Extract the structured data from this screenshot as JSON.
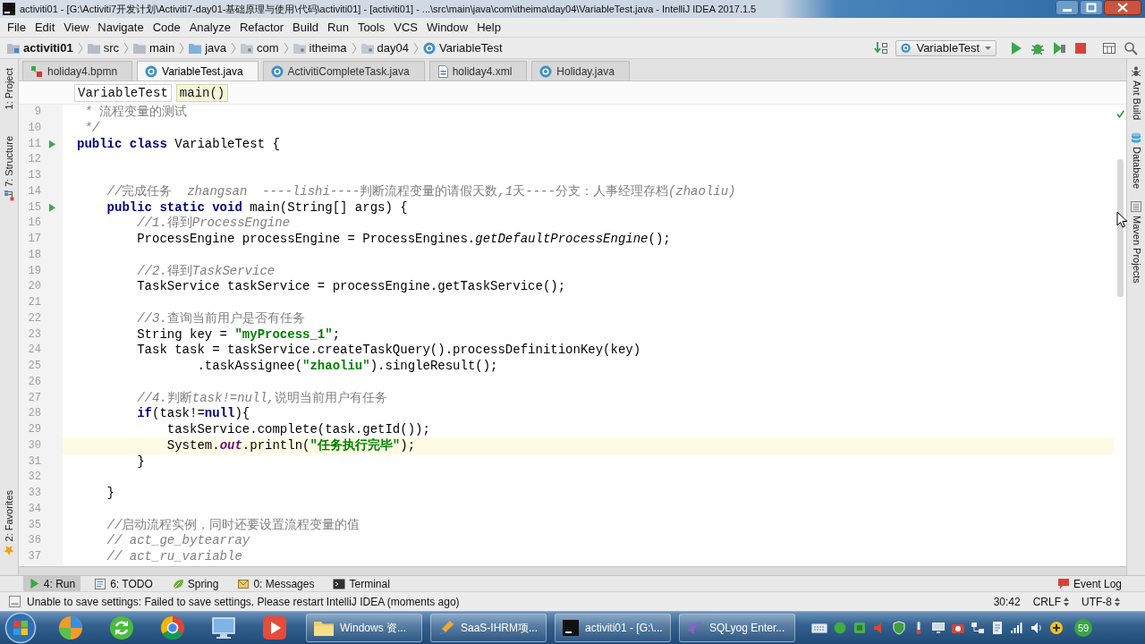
{
  "window": {
    "title": "activiti01 - [G:\\Activiti7开发计划\\Activiti7-day01-基础原理与使用\\代码\\activiti01] - [activiti01] - ...\\src\\main\\java\\com\\itheima\\day04\\VariableTest.java - IntelliJ IDEA 2017.1.5"
  },
  "menu": [
    "File",
    "Edit",
    "View",
    "Navigate",
    "Code",
    "Analyze",
    "Refactor",
    "Build",
    "Run",
    "Tools",
    "VCS",
    "Window",
    "Help"
  ],
  "navigation": {
    "breadcrumbs": [
      {
        "label": "activiti01",
        "kind": "module"
      },
      {
        "label": "src",
        "kind": "folder"
      },
      {
        "label": "main",
        "kind": "folder"
      },
      {
        "label": "java",
        "kind": "source"
      },
      {
        "label": "com",
        "kind": "package"
      },
      {
        "label": "itheima",
        "kind": "package"
      },
      {
        "label": "day04",
        "kind": "package"
      },
      {
        "label": "VariableTest",
        "kind": "class"
      }
    ],
    "run_configuration": "VariableTest"
  },
  "left_tool_strip": {
    "top": [
      {
        "label": "1: Project",
        "kind": "project"
      },
      {
        "label": "7: Structure",
        "kind": "structure"
      }
    ],
    "bottom": [
      {
        "label": "2: Favorites",
        "kind": "favorites"
      }
    ]
  },
  "tabs": [
    {
      "label": "holiday4.bpmn",
      "kind": "bpmn",
      "selected": false
    },
    {
      "label": "VariableTest.java",
      "kind": "java",
      "selected": true
    },
    {
      "label": "ActivitiCompleteTask.java",
      "kind": "java",
      "selected": false
    },
    {
      "label": "holiday4.xml",
      "kind": "xml",
      "selected": false
    },
    {
      "label": "Holiday.java",
      "kind": "java",
      "selected": false
    }
  ],
  "editor": {
    "breadcrumbs": [
      {
        "label": "VariableTest",
        "selected": false
      },
      {
        "label": "main()",
        "selected": true
      }
    ],
    "lines": [
      {
        "number": "9",
        "run_marker": false,
        "current": false,
        "segments": [
          {
            "kind": "comment",
            "text": " * 流程变量的测试"
          }
        ]
      },
      {
        "number": "10",
        "run_marker": false,
        "current": false,
        "segments": [
          {
            "kind": "comment",
            "text": " */"
          }
        ]
      },
      {
        "number": "11",
        "run_marker": true,
        "current": false,
        "segments": [
          {
            "kind": "keyword",
            "text": "public class"
          },
          {
            "kind": "plain",
            "text": " VariableTest {"
          }
        ]
      },
      {
        "number": "12",
        "run_marker": false,
        "current": false
      },
      {
        "number": "13",
        "run_marker": false,
        "current": false
      },
      {
        "number": "14",
        "run_marker": false,
        "current": false,
        "segments": [
          {
            "kind": "comment",
            "text": "    //完成任务  zhangsan  ----lishi----判断流程变量的请假天数,1天----分支：人事经理存档(zhaoliu)"
          }
        ]
      },
      {
        "number": "15",
        "run_marker": true,
        "current": false,
        "segments": [
          {
            "kind": "keyword",
            "text": "    public static void"
          },
          {
            "kind": "plain",
            "text": " main(String[] args) {"
          }
        ]
      },
      {
        "number": "16",
        "run_marker": false,
        "current": false,
        "segments": [
          {
            "kind": "comment",
            "text": "        //1.得到ProcessEngine"
          }
        ]
      },
      {
        "number": "17",
        "run_marker": false,
        "current": false,
        "segments": [
          {
            "kind": "plain",
            "text": "        ProcessEngine processEngine = ProcessEngines."
          },
          {
            "kind": "static-method",
            "text": "getDefaultProcessEngine"
          },
          {
            "kind": "plain",
            "text": "();"
          }
        ]
      },
      {
        "number": "18",
        "run_marker": false,
        "current": false
      },
      {
        "number": "19",
        "run_marker": false,
        "current": false,
        "segments": [
          {
            "kind": "comment",
            "text": "        //2.得到TaskService"
          }
        ]
      },
      {
        "number": "20",
        "run_marker": false,
        "current": false,
        "segments": [
          {
            "kind": "plain",
            "text": "        TaskService taskService = processEngine.getTaskService();"
          }
        ]
      },
      {
        "number": "21",
        "run_marker": false,
        "current": false
      },
      {
        "number": "22",
        "run_marker": false,
        "current": false,
        "segments": [
          {
            "kind": "comment",
            "text": "        //3.查询当前用户是否有任务"
          }
        ]
      },
      {
        "number": "23",
        "run_marker": false,
        "current": false,
        "segments": [
          {
            "kind": "plain",
            "text": "        String key = "
          },
          {
            "kind": "string",
            "text": "\"myProcess_1\""
          },
          {
            "kind": "plain",
            "text": ";"
          }
        ]
      },
      {
        "number": "24",
        "run_marker": false,
        "current": false,
        "segments": [
          {
            "kind": "plain",
            "text": "        Task task = taskService.createTaskQuery().processDefinitionKey(key)"
          }
        ]
      },
      {
        "number": "25",
        "run_marker": false,
        "current": false,
        "segments": [
          {
            "kind": "plain",
            "text": "                .taskAssignee("
          },
          {
            "kind": "string",
            "text": "\"zhaoliu\""
          },
          {
            "kind": "plain",
            "text": ").singleResult();"
          }
        ]
      },
      {
        "number": "26",
        "run_marker": false,
        "current": false
      },
      {
        "number": "27",
        "run_marker": false,
        "current": false,
        "segments": [
          {
            "kind": "comment",
            "text": "        //4.判断task!=null,说明当前用户有任务"
          }
        ]
      },
      {
        "number": "28",
        "run_marker": false,
        "current": false,
        "segments": [
          {
            "kind": "keyword",
            "text": "        if"
          },
          {
            "kind": "plain",
            "text": "(task!="
          },
          {
            "kind": "keyword",
            "text": "null"
          },
          {
            "kind": "plain",
            "text": "){"
          }
        ]
      },
      {
        "number": "29",
        "run_marker": false,
        "current": false,
        "segments": [
          {
            "kind": "plain",
            "text": "            taskService.complete(task.getId());"
          }
        ]
      },
      {
        "number": "30",
        "run_marker": false,
        "current": true,
        "segments": [
          {
            "kind": "plain",
            "text": "            System."
          },
          {
            "kind": "static-field",
            "text": "out"
          },
          {
            "kind": "plain",
            "text": ".println("
          },
          {
            "kind": "string",
            "text": "\"任务执行完毕\""
          },
          {
            "kind": "plain",
            "text": ");"
          }
        ]
      },
      {
        "number": "31",
        "run_marker": false,
        "current": false,
        "segments": [
          {
            "kind": "plain",
            "text": "        }"
          }
        ]
      },
      {
        "number": "32",
        "run_marker": false,
        "current": false
      },
      {
        "number": "33",
        "run_marker": false,
        "current": false,
        "segments": [
          {
            "kind": "plain",
            "text": "    }"
          }
        ]
      },
      {
        "number": "34",
        "run_marker": false,
        "current": false
      },
      {
        "number": "35",
        "run_marker": false,
        "current": false,
        "segments": [
          {
            "kind": "comment",
            "text": "    //启动流程实例，同时还要设置流程变量的值"
          }
        ]
      },
      {
        "number": "36",
        "run_marker": false,
        "current": false,
        "segments": [
          {
            "kind": "comment",
            "text": "    // act_ge_bytearray"
          }
        ]
      },
      {
        "number": "37",
        "run_marker": false,
        "current": false,
        "segments": [
          {
            "kind": "comment",
            "text": "    // act_ru_variable"
          }
        ]
      }
    ]
  },
  "right_tool_strip": [
    {
      "label": "Ant Build",
      "kind": "ant"
    },
    {
      "label": "Database",
      "kind": "database"
    },
    {
      "label": "Maven Projects",
      "kind": "maven"
    }
  ],
  "tool_window_bar": {
    "items": [
      {
        "label": "4: Run",
        "kind": "run",
        "selected": true
      },
      {
        "label": "6: TODO",
        "kind": "todo",
        "selected": false
      },
      {
        "label": "Spring",
        "kind": "spring",
        "selected": false
      },
      {
        "label": "0: Messages",
        "kind": "messages",
        "selected": false
      },
      {
        "label": "Terminal",
        "kind": "terminal",
        "selected": false
      }
    ],
    "event_log": "Event Log"
  },
  "status_bar": {
    "message": "Unable to save settings: Failed to save settings. Please restart IntelliJ IDEA (moments ago)",
    "position": "30:42",
    "line_separator": "CRLF",
    "encoding": "UTF-8"
  },
  "taskbar": {
    "tasks": [
      {
        "label": "Windows 资...",
        "kind": "folder"
      },
      {
        "label": "SaaS-IHRM项...",
        "kind": "document"
      },
      {
        "label": "activiti01 - [G:\\...",
        "kind": "ide"
      },
      {
        "label": "SQLyog Enter...",
        "kind": "database"
      }
    ],
    "tray_badge": "59"
  }
}
